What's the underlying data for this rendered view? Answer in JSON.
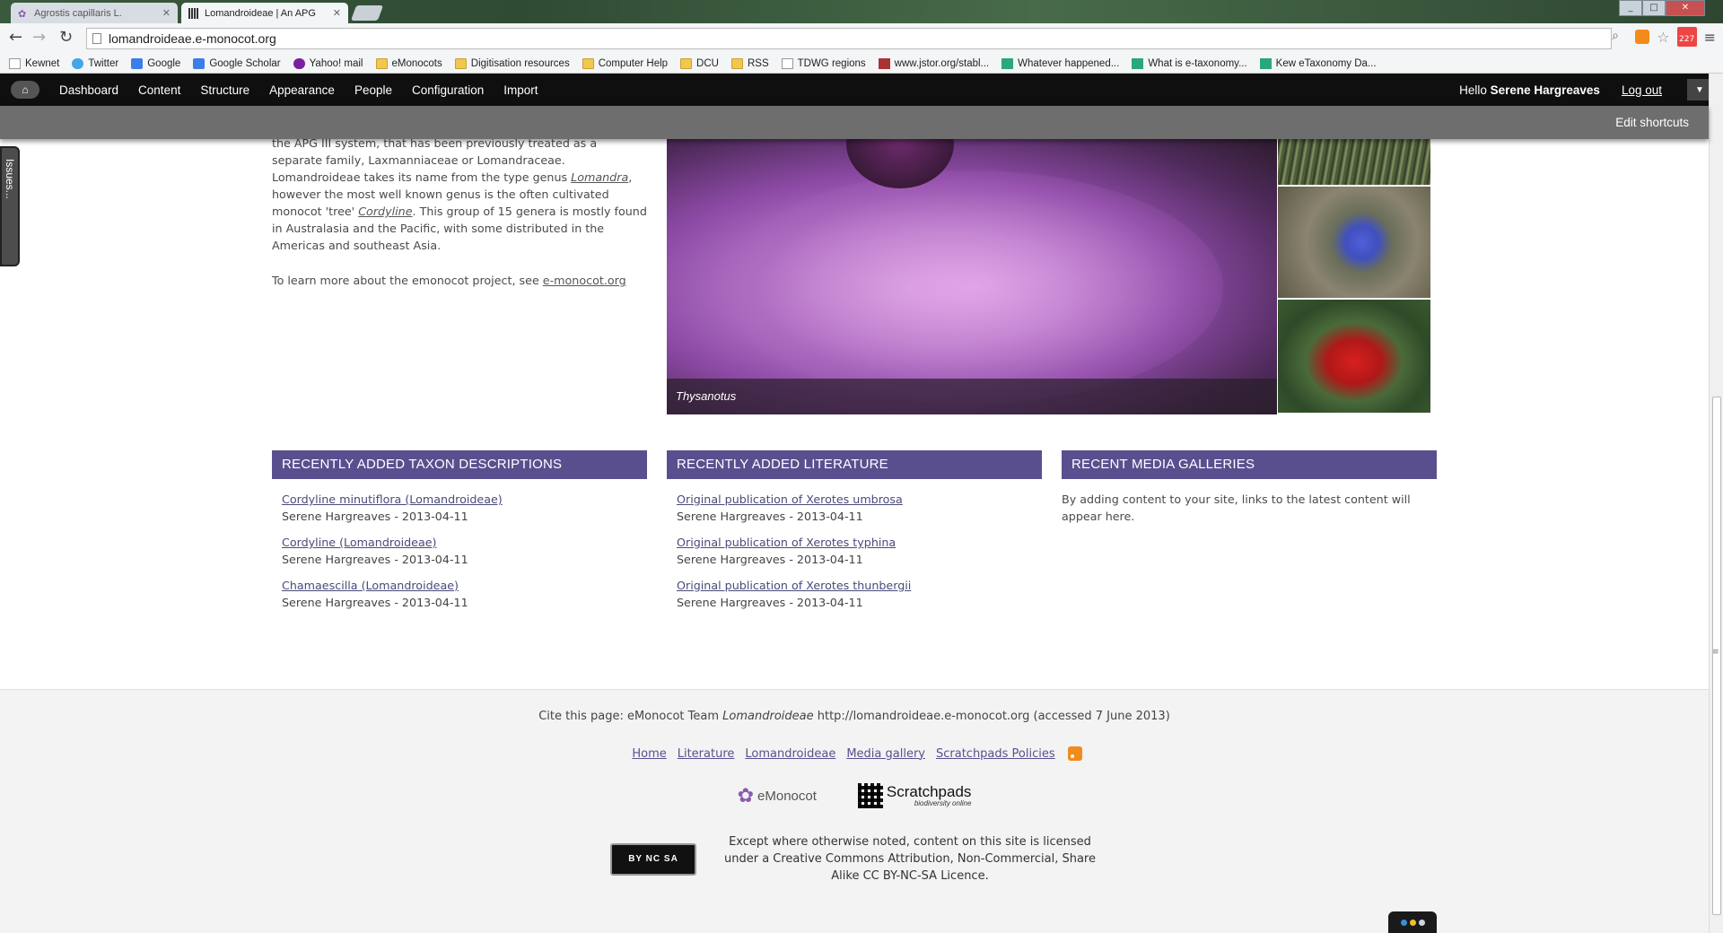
{
  "browser": {
    "tabs": [
      {
        "title": "Agrostis capillaris L.",
        "active": false
      },
      {
        "title": "Lomandroideae | An APG",
        "active": true
      }
    ],
    "url": "lomandroideae.e-monocot.org",
    "ext_badge": "227",
    "bookmarks": [
      {
        "label": "Kewnet",
        "icon": "page-icon"
      },
      {
        "label": "Twitter",
        "icon": "twitter-icon"
      },
      {
        "label": "Google",
        "icon": "google-icon"
      },
      {
        "label": "Google Scholar",
        "icon": "google-scholar-icon"
      },
      {
        "label": "Yahoo! mail",
        "icon": "yahoo-icon"
      },
      {
        "label": "eMonocots",
        "icon": "folder-icon"
      },
      {
        "label": "Digitisation resources",
        "icon": "folder-icon"
      },
      {
        "label": "Computer Help",
        "icon": "folder-icon"
      },
      {
        "label": "DCU",
        "icon": "folder-icon"
      },
      {
        "label": "RSS",
        "icon": "folder-icon"
      },
      {
        "label": "TDWG regions",
        "icon": "page-icon"
      },
      {
        "label": "www.jstor.org/stabl...",
        "icon": "jstor-icon"
      },
      {
        "label": "Whatever happened...",
        "icon": "web-icon"
      },
      {
        "label": "What is e-taxonomy...",
        "icon": "web-icon"
      },
      {
        "label": "Kew eTaxonomy Da...",
        "icon": "web-icon"
      }
    ]
  },
  "admin": {
    "menu": [
      "Dashboard",
      "Content",
      "Structure",
      "Appearance",
      "People",
      "Configuration",
      "Import"
    ],
    "hello_prefix": "Hello",
    "user": "Serene Hargreaves",
    "logout": "Log out",
    "edit_shortcuts": "Edit shortcuts",
    "issues_tab": "Issues..."
  },
  "intro": {
    "p1_a": "the APG III system, that has been previously treated as a separate family, Laxmanniaceae or Lomandraceae. Lomandroideae takes its name from the type genus ",
    "p1_link1": "Lomandra",
    "p1_b": ", however the most well known genus is the often cultivated monocot 'tree' ",
    "p1_link2": "Cordyline",
    "p1_c": ". This group of 15 genera is mostly found in Australasia and the Pacific, with some distributed in the Americas and southeast Asia.",
    "p2_text": "To learn more about the emonocot project, see ",
    "p2_link": "e-monocot.org"
  },
  "gallery": {
    "caption": "Thysanotus"
  },
  "blocks": {
    "taxon": {
      "title": "RECENTLY ADDED TAXON DESCRIPTIONS",
      "items": [
        {
          "link": "Cordyline minutiflora (Lomandroideae)",
          "meta": "Serene Hargreaves - 2013-04-11"
        },
        {
          "link": "Cordyline (Lomandroideae)",
          "meta": "Serene Hargreaves - 2013-04-11"
        },
        {
          "link": "Chamaescilla (Lomandroideae)",
          "meta": "Serene Hargreaves - 2013-04-11"
        }
      ]
    },
    "literature": {
      "title": "RECENTLY ADDED LITERATURE",
      "items": [
        {
          "link": "Original publication of Xerotes umbrosa",
          "meta": "Serene Hargreaves - 2013-04-11"
        },
        {
          "link": "Original publication of Xerotes typhina",
          "meta": "Serene Hargreaves - 2013-04-11"
        },
        {
          "link": "Original publication of Xerotes thunbergii",
          "meta": "Serene Hargreaves - 2013-04-11"
        }
      ]
    },
    "media": {
      "title": "RECENT MEDIA GALLERIES",
      "empty_text": "By adding content to your site, links to the latest content will appear here."
    }
  },
  "footer": {
    "cite_prefix": "Cite this page: eMonocot Team ",
    "cite_italic": "Lomandroideae",
    "cite_suffix": " http://lomandroideae.e-monocot.org (accessed 7 June 2013)",
    "links": [
      "Home",
      "Literature",
      "Lomandroideae",
      "Media gallery",
      "Scratchpads Policies"
    ],
    "logo_emonocot": "eMonocot",
    "logo_scratchpads": "Scratchpads",
    "logo_scratchpads_sub": "biodiversity online",
    "cc_badge": "BY NC SA",
    "license_text": "Except where otherwise noted, content on this site is licensed under a Creative Commons Attribution, Non-Commercial, Share Alike CC BY-NC-SA Licence."
  },
  "colors": {
    "block_header": "#5a4f8e",
    "admin_bar": "#0f0f0f",
    "shortcut_bar": "#6e6e6e"
  }
}
